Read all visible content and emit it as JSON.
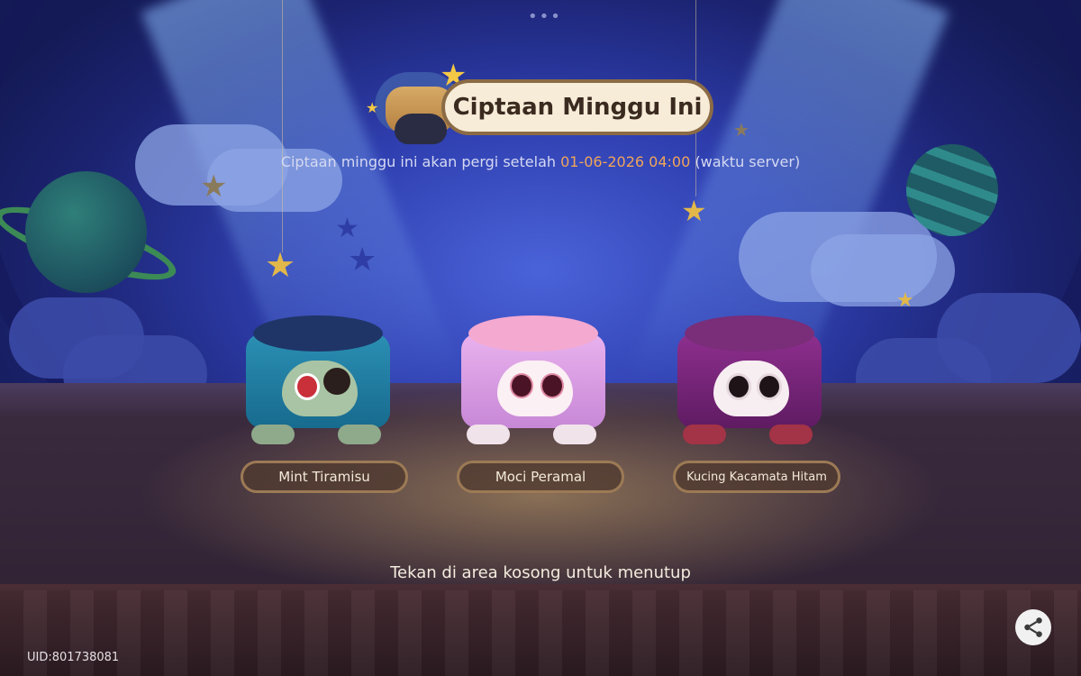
{
  "title": {
    "label": "Ciptaan Minggu Ini"
  },
  "subtitle": {
    "prefix": "Ciptaan minggu ini akan pergi setelah",
    "datetime": "01-06-2026 04:00",
    "suffix": "(waktu server)"
  },
  "creations": [
    {
      "name": "Mint Tiramisu"
    },
    {
      "name": "Moci Peramal"
    },
    {
      "name": "Kucing Kacamata Hitam"
    }
  ],
  "close_hint": "Tekan di area kosong untuk menutup",
  "uid": "UID:801738081",
  "icons": {
    "share": "share-icon",
    "menu": "more-dots-icon"
  },
  "colors": {
    "highlight": "#f0a55a",
    "title_text": "#3b2a1f",
    "pill_border": "#9c7a55"
  }
}
